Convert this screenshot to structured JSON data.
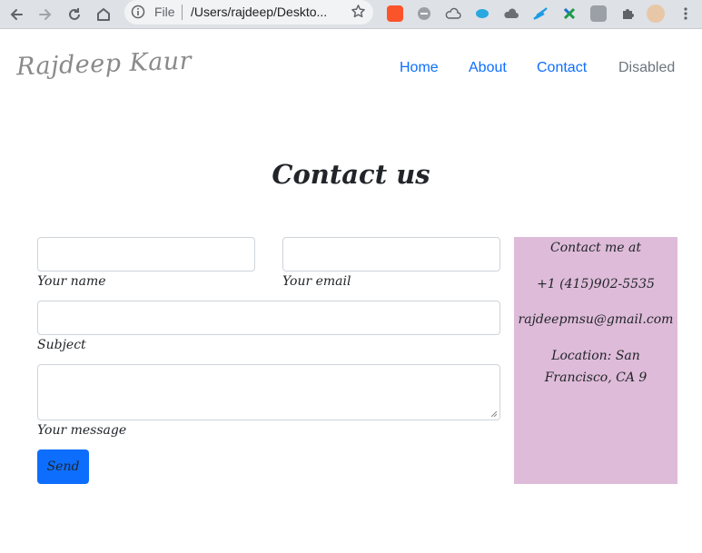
{
  "browser": {
    "omnibox_scheme": "File",
    "url": "/Users/rajdeep/Deskto...",
    "colors": {
      "chrome_bg": "#dee1e6",
      "omnibox_bg": "#f1f3f4"
    },
    "extensions": [
      "brave-lion-icon",
      "ghost-icon",
      "cloud-icon",
      "fish-icon",
      "dark-cloud-icon",
      "feather-icon",
      "cross-x-icon",
      "grid-ext-icon",
      "puzzle-icon",
      "profile-avatar"
    ]
  },
  "site": {
    "logo": "Rajdeep Kaur",
    "nav": {
      "home": "Home",
      "about": "About",
      "contact": "Contact",
      "disabled": "Disabled"
    },
    "heading": "Contact us",
    "form": {
      "name_label": "Your name",
      "email_label": "Your email",
      "subject_label": "Subject",
      "message_label": "Your message",
      "send_label": "Send",
      "name_value": "",
      "email_value": "",
      "subject_value": "",
      "message_value": ""
    },
    "contact_box": {
      "title": "Contact me at",
      "phone": "+1 (415)902-5535",
      "email": "rajdeepmsu@gmail.com",
      "location_line1": "Location: San",
      "location_line2": "Francisco, CA 9"
    },
    "colors": {
      "link": "#0d6efd",
      "disabled": "#6c757d",
      "button": "#0d6efd",
      "contact_box_bg": "#debbd9"
    }
  }
}
